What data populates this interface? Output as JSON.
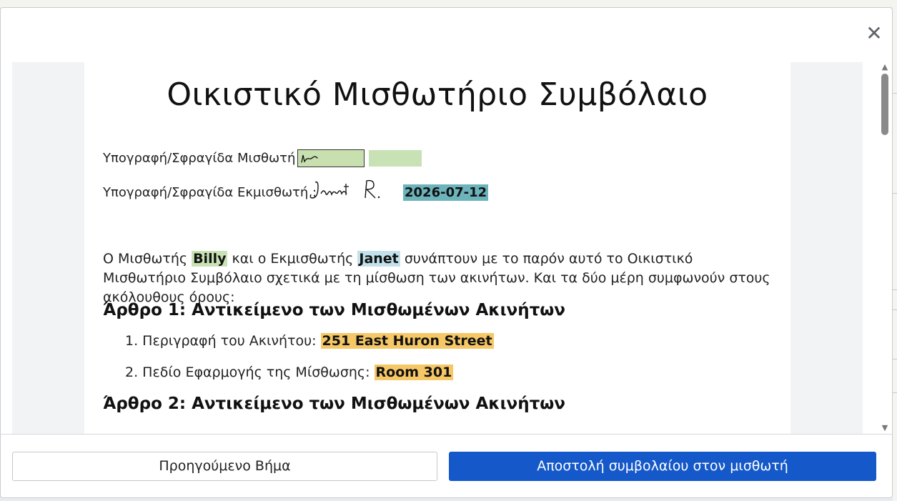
{
  "document": {
    "title": "Οικιστικό Μισθωτήριο Συμβόλαιο",
    "tenant_signature_label": "Υπογραφή/Σφραγίδα Μισθωτή :",
    "landlord_signature_label": "Υπογραφή/Σφραγίδα Εκμισθωτή :",
    "landlord_sign_date": "2026-07-12",
    "intro": {
      "part1": "Ο Μισθωτής",
      "tenant_name": "Billy",
      "part2": "και ο Εκμισθωτής",
      "landlord_name": "Janet",
      "part3": "συνάπτουν με το παρόν αυτό το Οικιστικό Μισθωτήριο Συμβόλαιο σχετικά με τη μίσθωση των ακινήτων. Και τα δύο μέρη συμφωνούν στους ακόλουθους όρους:"
    },
    "article1": {
      "heading": "Άρθρο 1: Αντικείμενο των Μισθωμένων Ακινήτων",
      "items": [
        {
          "label": "1. Περιγραφή του Ακινήτου:",
          "value": "251 East Huron Street"
        },
        {
          "label": "2. Πεδίο Εφαρμογής της Μίσθωσης:",
          "value": "Room 301"
        }
      ]
    },
    "article2": {
      "heading": "Άρθρο 2: Αντικείμενο των Μισθωμένων Ακινήτων"
    }
  },
  "footer": {
    "prev_label": "Προηγούμενο Βήμα",
    "send_label": "Αποστολή συμβολαίου στον μισθωτή"
  },
  "icons": {
    "close": "close-icon",
    "scroll_up": "scroll-up-icon",
    "scroll_down": "scroll-down-icon"
  },
  "colors": {
    "primary_button": "#1458c9",
    "field_highlight": "#c9e2b5",
    "date_highlight": "#6cb3bc",
    "landlord_highlight": "#c3e1ea",
    "value_highlight": "#f6c766"
  }
}
